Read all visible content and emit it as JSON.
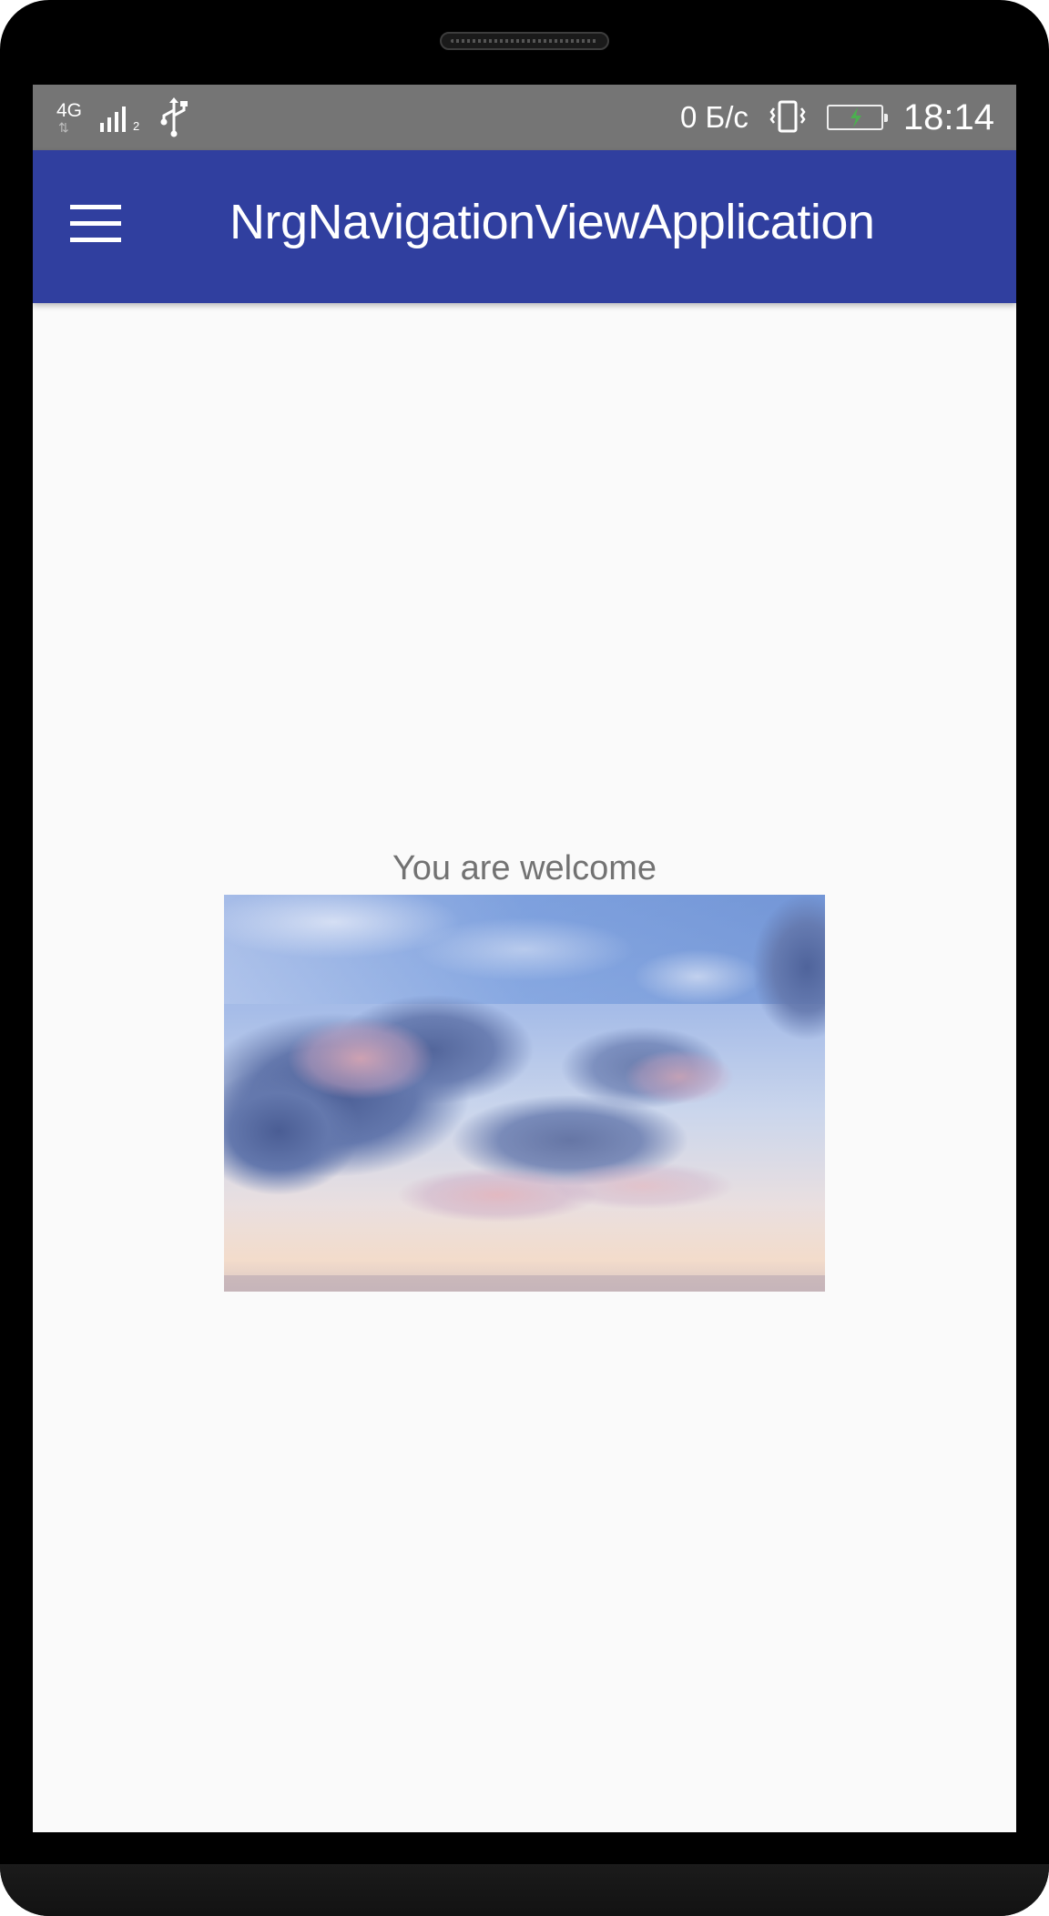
{
  "status_bar": {
    "network_type": "4G",
    "signal_sim_index": "2",
    "data_speed": "0 Б/с",
    "time": "18:14",
    "icons": [
      "signal-icon",
      "usb-icon",
      "vibrate-icon",
      "battery-charging-icon"
    ]
  },
  "app_bar": {
    "title": "NrgNavigationViewApplication",
    "menu_icon": "menu-icon",
    "color": "#303f9f"
  },
  "content": {
    "welcome_text": "You are welcome",
    "image_subject": "sky-with-clouds"
  },
  "colors": {
    "status_bar": "#757575",
    "background": "#fafafa",
    "text_secondary": "#727272"
  }
}
